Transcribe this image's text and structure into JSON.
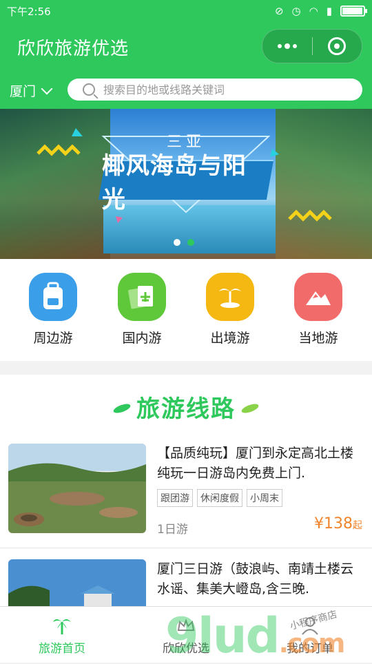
{
  "status": {
    "time": "下午2:56",
    "battery_level": 0.9
  },
  "header": {
    "title": "欣欣旅游优选"
  },
  "search": {
    "city": "厦门",
    "placeholder": "搜索目的地或线路关键词"
  },
  "banner": {
    "subtitle": "三亚",
    "title": "椰风海岛与阳光",
    "active_dot": 1
  },
  "categories": [
    {
      "label": "周边游",
      "color": "#3a9fe8",
      "icon": "backpack-icon"
    },
    {
      "label": "国内游",
      "color": "#5ec83a",
      "icon": "ticket-plane-icon"
    },
    {
      "label": "出境游",
      "color": "#f5b812",
      "icon": "palm-island-icon"
    },
    {
      "label": "当地游",
      "color": "#f26b6b",
      "icon": "mountain-icon"
    }
  ],
  "routes": {
    "section_title": "旅游线路",
    "items": [
      {
        "title": "【品质纯玩】厦门到永定高北土楼纯玩一日游岛内免费上门.",
        "tags": [
          "跟团游",
          "休闲度假",
          "小周末"
        ],
        "duration": "1日游",
        "price": "¥138",
        "price_suffix": "起"
      },
      {
        "title": "厦门三日游（鼓浪屿、南靖土楼云水谣、集美大嶝岛,含三晚."
      }
    ]
  },
  "tabbar": [
    {
      "label": "旅游首页",
      "active": true
    },
    {
      "label": "欣欣优选",
      "active": false
    },
    {
      "label": "我的订单",
      "active": false
    }
  ],
  "watermark": {
    "main": "9lud",
    "suffix": ".com",
    "side": "小程序商店"
  },
  "colors": {
    "primary": "#2ec85c",
    "price": "#f0852d"
  }
}
